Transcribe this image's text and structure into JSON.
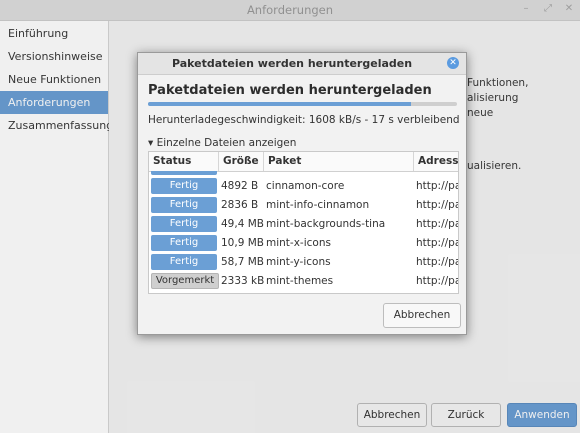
{
  "window": {
    "title": "Anforderungen"
  },
  "sidebar": {
    "items": [
      {
        "label": "Einführung"
      },
      {
        "label": "Versionshinweise"
      },
      {
        "label": "Neue Funktionen"
      },
      {
        "label": "Anforderungen"
      },
      {
        "label": "Zusammenfassung"
      }
    ],
    "active_index": 3
  },
  "background": {
    "fragments": [
      "Funktionen,",
      "alisierung",
      "neue",
      "ualisieren."
    ]
  },
  "footer": {
    "back_label": "Abbrechen",
    "previous_label": "Zurück",
    "apply_label": "Anwenden"
  },
  "dialog": {
    "title": "Paketdateien werden heruntergeladen",
    "heading": "Paketdateien werden heruntergeladen",
    "progress": 0.85,
    "speed": "Herunterladegeschwindigkeit: 1608 kB/s - 17 s verbleibend",
    "expander_label": "Einzelne Dateien anzeigen",
    "columns": [
      "Status",
      "Größe",
      "Paket",
      "Adresse"
    ],
    "rows": [
      {
        "status": "Fertig",
        "size": "4892  B",
        "package": "cinnamon-core",
        "address": "http://pa"
      },
      {
        "status": "Fertig",
        "size": "2836  B",
        "package": "mint-info-cinnamon",
        "address": "http://pa"
      },
      {
        "status": "Fertig",
        "size": "49,4 MB",
        "package": "mint-backgrounds-tina",
        "address": "http://pa"
      },
      {
        "status": "Fertig",
        "size": "10,9 MB",
        "package": "mint-x-icons",
        "address": "http://pa"
      },
      {
        "status": "Fertig",
        "size": "58,7 MB",
        "package": "mint-y-icons",
        "address": "http://pa"
      },
      {
        "status": "Vorgemerkt",
        "size": "2333 kB",
        "package": "mint-themes",
        "address": "http://pa"
      }
    ],
    "cancel_label": "Abbrechen"
  },
  "colors": {
    "accent": "#6b9fd5"
  },
  "icons": {
    "expander": "triangle-down-icon",
    "close": "close-icon"
  }
}
